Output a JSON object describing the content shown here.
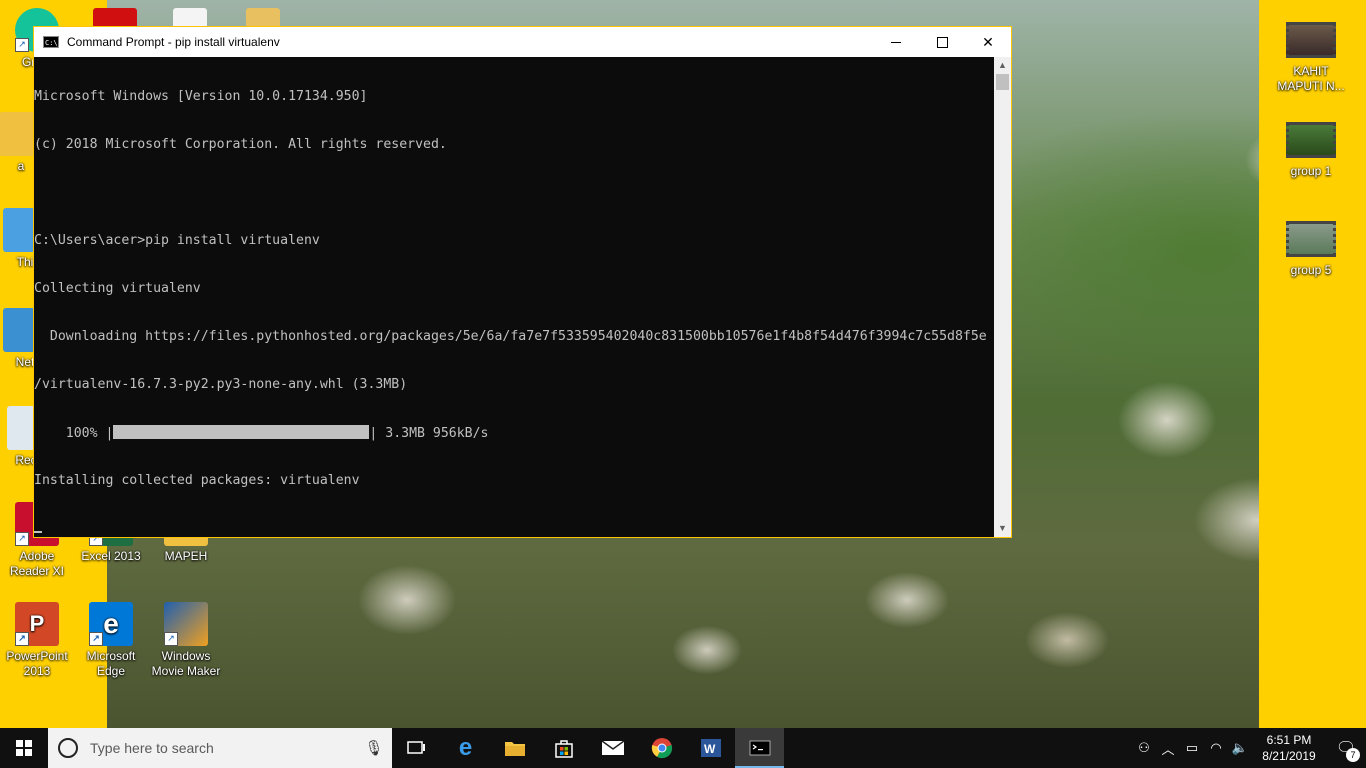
{
  "window": {
    "title": "Command Prompt - pip  install virtualenv",
    "icon_label": "C:\\_",
    "minimize_label": "",
    "maximize_label": "",
    "close_label": "✕"
  },
  "console": {
    "lines": [
      "Microsoft Windows [Version 10.0.17134.950]",
      "(c) 2018 Microsoft Corporation. All rights reserved.",
      "",
      "C:\\Users\\acer>pip install virtualenv",
      "Collecting virtualenv",
      "  Downloading https://files.pythonhosted.org/packages/5e/6a/fa7e7f533595402040c831500bb10576e1f4b8f54d476f3994c7c55d8f5e",
      "/virtualenv-16.7.3-py2.py3-none-any.whl (3.3MB)"
    ],
    "progress_prefix": "    100% |",
    "progress_suffix": "| 3.3MB 956kB/s",
    "progress_fraction": 1.0,
    "after_lines": [
      "Installing collected packages: virtualenv"
    ]
  },
  "desktop_left": [
    {
      "label": "Gram",
      "color": "#15c39a",
      "name": "grammarly"
    },
    {
      "label": "Adobe Reader XI",
      "color": "#c8102e",
      "name": "adobe-reader"
    },
    {
      "label": "Excel 2013",
      "color": "#1d6f42",
      "name": "excel"
    },
    {
      "label": "MAPEH",
      "color": "#f0c040",
      "name": "mapeh-folder"
    },
    {
      "label": "PowerPoint 2013",
      "color": "#d24726",
      "name": "powerpoint"
    },
    {
      "label": "Microsoft Edge",
      "color": "#0078d7",
      "name": "edge"
    },
    {
      "label": "Windows Movie Maker",
      "color": "#2060b0",
      "name": "movie-maker"
    }
  ],
  "desktop_partial": [
    "a",
    "Thi",
    "Net",
    "Recy"
  ],
  "desktop_right": [
    {
      "label": "KAHIT MAPUTI N...",
      "name": "kahit-maputi"
    },
    {
      "label": "group 1",
      "name": "group-1"
    },
    {
      "label": "group 5",
      "name": "group-5"
    }
  ],
  "taskbar": {
    "search_placeholder": "Type here to search",
    "time": "6:51 PM",
    "date": "8/21/2019",
    "notification_count": "7"
  },
  "colors": {
    "desktop_bg": "#ffd000",
    "console_bg": "#0c0c0c",
    "console_fg": "#c0c0c0",
    "taskbar_bg": "#101010",
    "accent": "#76b9ed"
  }
}
